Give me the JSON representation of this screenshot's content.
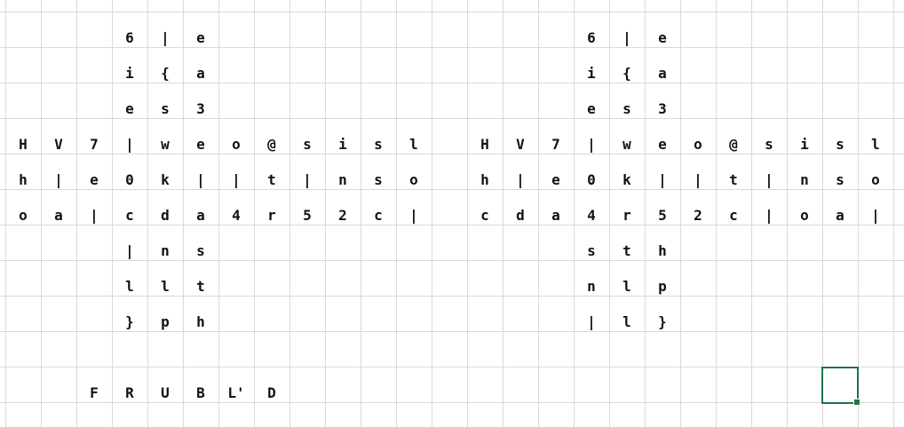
{
  "puzzle_left": [
    {
      "r": 0,
      "c": 3,
      "v": "6"
    },
    {
      "r": 0,
      "c": 4,
      "v": "|"
    },
    {
      "r": 0,
      "c": 5,
      "v": "e"
    },
    {
      "r": 1,
      "c": 3,
      "v": "i"
    },
    {
      "r": 1,
      "c": 4,
      "v": "{"
    },
    {
      "r": 1,
      "c": 5,
      "v": "a"
    },
    {
      "r": 2,
      "c": 3,
      "v": "e"
    },
    {
      "r": 2,
      "c": 4,
      "v": "s"
    },
    {
      "r": 2,
      "c": 5,
      "v": "3"
    },
    {
      "r": 3,
      "c": 0,
      "v": "H"
    },
    {
      "r": 3,
      "c": 1,
      "v": "V"
    },
    {
      "r": 3,
      "c": 2,
      "v": "7"
    },
    {
      "r": 3,
      "c": 3,
      "v": "|"
    },
    {
      "r": 3,
      "c": 4,
      "v": "w"
    },
    {
      "r": 3,
      "c": 5,
      "v": "e"
    },
    {
      "r": 3,
      "c": 6,
      "v": "o"
    },
    {
      "r": 3,
      "c": 7,
      "v": "@"
    },
    {
      "r": 3,
      "c": 8,
      "v": "s"
    },
    {
      "r": 3,
      "c": 9,
      "v": "i"
    },
    {
      "r": 3,
      "c": 10,
      "v": "s"
    },
    {
      "r": 3,
      "c": 11,
      "v": "l"
    },
    {
      "r": 4,
      "c": 0,
      "v": "h"
    },
    {
      "r": 4,
      "c": 1,
      "v": "|"
    },
    {
      "r": 4,
      "c": 2,
      "v": "e"
    },
    {
      "r": 4,
      "c": 3,
      "v": "0"
    },
    {
      "r": 4,
      "c": 4,
      "v": "k"
    },
    {
      "r": 4,
      "c": 5,
      "v": "|"
    },
    {
      "r": 4,
      "c": 6,
      "v": "|"
    },
    {
      "r": 4,
      "c": 7,
      "v": "t"
    },
    {
      "r": 4,
      "c": 8,
      "v": "|"
    },
    {
      "r": 4,
      "c": 9,
      "v": "n"
    },
    {
      "r": 4,
      "c": 10,
      "v": "s"
    },
    {
      "r": 4,
      "c": 11,
      "v": "o"
    },
    {
      "r": 5,
      "c": 0,
      "v": "o"
    },
    {
      "r": 5,
      "c": 1,
      "v": "a"
    },
    {
      "r": 5,
      "c": 2,
      "v": "|"
    },
    {
      "r": 5,
      "c": 3,
      "v": "c"
    },
    {
      "r": 5,
      "c": 4,
      "v": "d"
    },
    {
      "r": 5,
      "c": 5,
      "v": "a"
    },
    {
      "r": 5,
      "c": 6,
      "v": "4"
    },
    {
      "r": 5,
      "c": 7,
      "v": "r"
    },
    {
      "r": 5,
      "c": 8,
      "v": "5"
    },
    {
      "r": 5,
      "c": 9,
      "v": "2"
    },
    {
      "r": 5,
      "c": 10,
      "v": "c"
    },
    {
      "r": 5,
      "c": 11,
      "v": "|"
    },
    {
      "r": 6,
      "c": 3,
      "v": "|"
    },
    {
      "r": 6,
      "c": 4,
      "v": "n"
    },
    {
      "r": 6,
      "c": 5,
      "v": "s"
    },
    {
      "r": 7,
      "c": 3,
      "v": "l"
    },
    {
      "r": 7,
      "c": 4,
      "v": "l"
    },
    {
      "r": 7,
      "c": 5,
      "v": "t"
    },
    {
      "r": 8,
      "c": 3,
      "v": "}"
    },
    {
      "r": 8,
      "c": 4,
      "v": "p"
    },
    {
      "r": 8,
      "c": 5,
      "v": "h"
    }
  ],
  "puzzle_right": [
    {
      "r": 0,
      "c": 16,
      "v": "6"
    },
    {
      "r": 0,
      "c": 17,
      "v": "|"
    },
    {
      "r": 0,
      "c": 18,
      "v": "e"
    },
    {
      "r": 1,
      "c": 16,
      "v": "i"
    },
    {
      "r": 1,
      "c": 17,
      "v": "{"
    },
    {
      "r": 1,
      "c": 18,
      "v": "a"
    },
    {
      "r": 2,
      "c": 16,
      "v": "e"
    },
    {
      "r": 2,
      "c": 17,
      "v": "s"
    },
    {
      "r": 2,
      "c": 18,
      "v": "3"
    },
    {
      "r": 3,
      "c": 13,
      "v": "H"
    },
    {
      "r": 3,
      "c": 14,
      "v": "V"
    },
    {
      "r": 3,
      "c": 15,
      "v": "7"
    },
    {
      "r": 3,
      "c": 16,
      "v": "|"
    },
    {
      "r": 3,
      "c": 17,
      "v": "w"
    },
    {
      "r": 3,
      "c": 18,
      "v": "e"
    },
    {
      "r": 3,
      "c": 19,
      "v": "o"
    },
    {
      "r": 3,
      "c": 20,
      "v": "@"
    },
    {
      "r": 3,
      "c": 21,
      "v": "s"
    },
    {
      "r": 3,
      "c": 22,
      "v": "i"
    },
    {
      "r": 3,
      "c": 23,
      "v": "s"
    },
    {
      "r": 3,
      "c": 24,
      "v": "l"
    },
    {
      "r": 4,
      "c": 13,
      "v": "h"
    },
    {
      "r": 4,
      "c": 14,
      "v": "|"
    },
    {
      "r": 4,
      "c": 15,
      "v": "e"
    },
    {
      "r": 4,
      "c": 16,
      "v": "0"
    },
    {
      "r": 4,
      "c": 17,
      "v": "k"
    },
    {
      "r": 4,
      "c": 18,
      "v": "|"
    },
    {
      "r": 4,
      "c": 19,
      "v": "|"
    },
    {
      "r": 4,
      "c": 20,
      "v": "t"
    },
    {
      "r": 4,
      "c": 21,
      "v": "|"
    },
    {
      "r": 4,
      "c": 22,
      "v": "n"
    },
    {
      "r": 4,
      "c": 23,
      "v": "s"
    },
    {
      "r": 4,
      "c": 24,
      "v": "o"
    },
    {
      "r": 5,
      "c": 13,
      "v": "c"
    },
    {
      "r": 5,
      "c": 14,
      "v": "d"
    },
    {
      "r": 5,
      "c": 15,
      "v": "a"
    },
    {
      "r": 5,
      "c": 16,
      "v": "4"
    },
    {
      "r": 5,
      "c": 17,
      "v": "r"
    },
    {
      "r": 5,
      "c": 18,
      "v": "5"
    },
    {
      "r": 5,
      "c": 19,
      "v": "2"
    },
    {
      "r": 5,
      "c": 20,
      "v": "c"
    },
    {
      "r": 5,
      "c": 21,
      "v": "|"
    },
    {
      "r": 5,
      "c": 22,
      "v": "o"
    },
    {
      "r": 5,
      "c": 23,
      "v": "a"
    },
    {
      "r": 5,
      "c": 24,
      "v": "|"
    },
    {
      "r": 6,
      "c": 16,
      "v": "s"
    },
    {
      "r": 6,
      "c": 17,
      "v": "t"
    },
    {
      "r": 6,
      "c": 18,
      "v": "h"
    },
    {
      "r": 7,
      "c": 16,
      "v": "n"
    },
    {
      "r": 7,
      "c": 17,
      "v": "l"
    },
    {
      "r": 7,
      "c": 18,
      "v": "p"
    },
    {
      "r": 8,
      "c": 16,
      "v": "|"
    },
    {
      "r": 8,
      "c": 17,
      "v": "l"
    },
    {
      "r": 8,
      "c": 18,
      "v": "}"
    }
  ],
  "moves": [
    {
      "r": 10,
      "c": 2,
      "v": "F"
    },
    {
      "r": 10,
      "c": 3,
      "v": "R"
    },
    {
      "r": 10,
      "c": 4,
      "v": "U"
    },
    {
      "r": 10,
      "c": 5,
      "v": "B"
    },
    {
      "r": 10,
      "c": 6,
      "v": "L'"
    },
    {
      "r": 10,
      "c": 7,
      "v": "D"
    }
  ],
  "selection": {
    "r": 10,
    "c": 23
  }
}
